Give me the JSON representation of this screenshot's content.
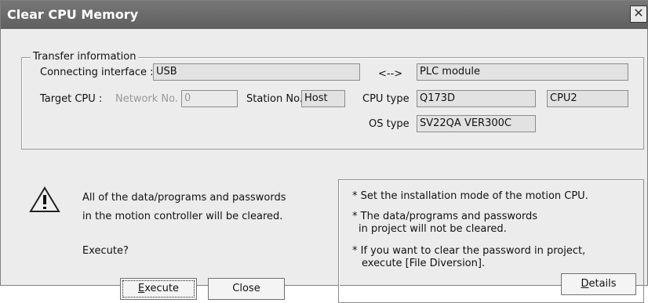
{
  "window": {
    "title": "Clear CPU Memory",
    "close_symbol": "✕"
  },
  "transfer": {
    "legend": "Transfer information",
    "connecting_interface_label": "Connecting interface :",
    "connecting_interface_value": "USB",
    "arrow": "<-->",
    "plc_module_value": "PLC module",
    "target_cpu_label": "Target CPU :",
    "network_no_label": "Network No.",
    "network_no_value": "0",
    "station_no_label": "Station No.",
    "station_no_value": "Host",
    "cpu_type_label": "CPU type",
    "cpu_type_value": "Q173D",
    "cpu_slot_value": "CPU2",
    "os_type_label": "OS type",
    "os_type_value": "SV22QA VER300C"
  },
  "message": {
    "line1": "All of the data/programs and passwords",
    "line2": "in the motion controller will be cleared.",
    "prompt": "Execute?",
    "icon": "warning-triangle"
  },
  "buttons": {
    "execute_first": "E",
    "execute_rest": "xecute",
    "close": "Close",
    "details_first": "D",
    "details_rest": "etails"
  },
  "notes": {
    "n1": "* Set the installation mode of the motion CPU.",
    "n2a": "* The data/programs and passwords",
    "n2b": "in project will not be cleared.",
    "n3a": "* If you want to clear the password in project,",
    "n3b": "execute [File Diversion]."
  }
}
